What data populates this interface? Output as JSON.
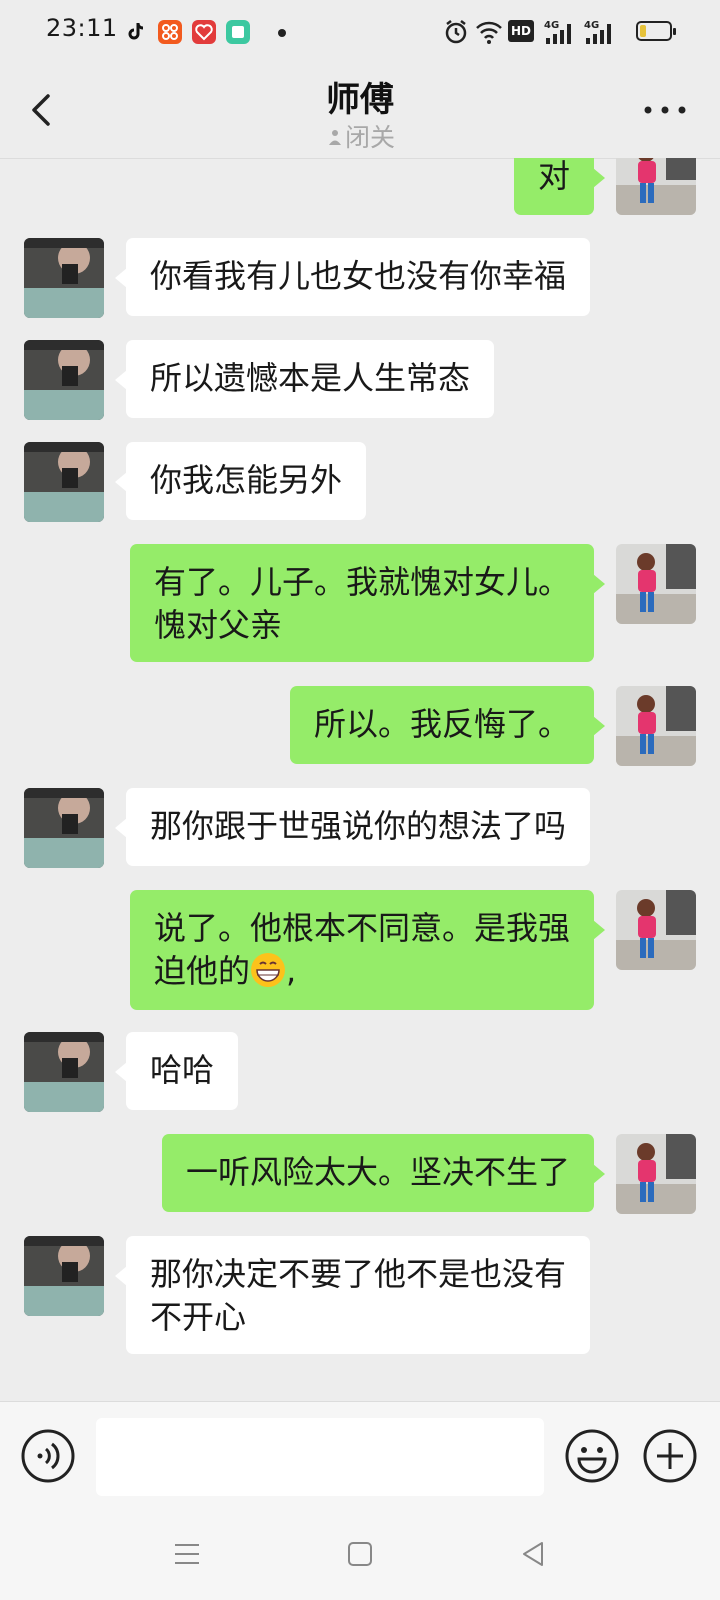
{
  "status_bar": {
    "time": "23:11",
    "network_1": "4G",
    "network_2": "4G",
    "hd_label": "HD",
    "battery_level": 0.2
  },
  "header": {
    "title": "师傅",
    "subtitle": "闭关"
  },
  "messages": [
    {
      "side": "right",
      "text": "对"
    },
    {
      "side": "left",
      "text": "你看我有儿也女也没有你幸福"
    },
    {
      "side": "left",
      "text": "所以遗憾本是人生常态"
    },
    {
      "side": "left",
      "text": "你我怎能另外"
    },
    {
      "side": "right",
      "text": "有了。儿子。我就愧对女儿。\n愧对父亲"
    },
    {
      "side": "right",
      "text": "所以。我反悔了。"
    },
    {
      "side": "left",
      "text": "那你跟于世强说你的想法了吗"
    },
    {
      "side": "right",
      "text_before_emoji": "说了。他根本不同意。是我强\n迫他的",
      "emoji": "grinning-face",
      "text_after_emoji": ","
    },
    {
      "side": "left",
      "text": "哈哈"
    },
    {
      "side": "right",
      "text": "一听风险太大。坚决不生了"
    },
    {
      "side": "left",
      "text": "那你决定不要了他不是也没有\n不开心"
    }
  ],
  "input_bar": {
    "placeholder": "",
    "value": ""
  },
  "icons": {
    "back": "chevron-left-icon",
    "more": "more-dots-icon",
    "voice": "voice-icon",
    "emoji": "emoji-icon",
    "plus": "plus-icon",
    "subtitle_status": "meditation-icon"
  },
  "colors": {
    "background": "#ededed",
    "bubble_sent": "#95ec69",
    "bubble_received": "#ffffff",
    "subtitle": "#a8a8a8"
  }
}
